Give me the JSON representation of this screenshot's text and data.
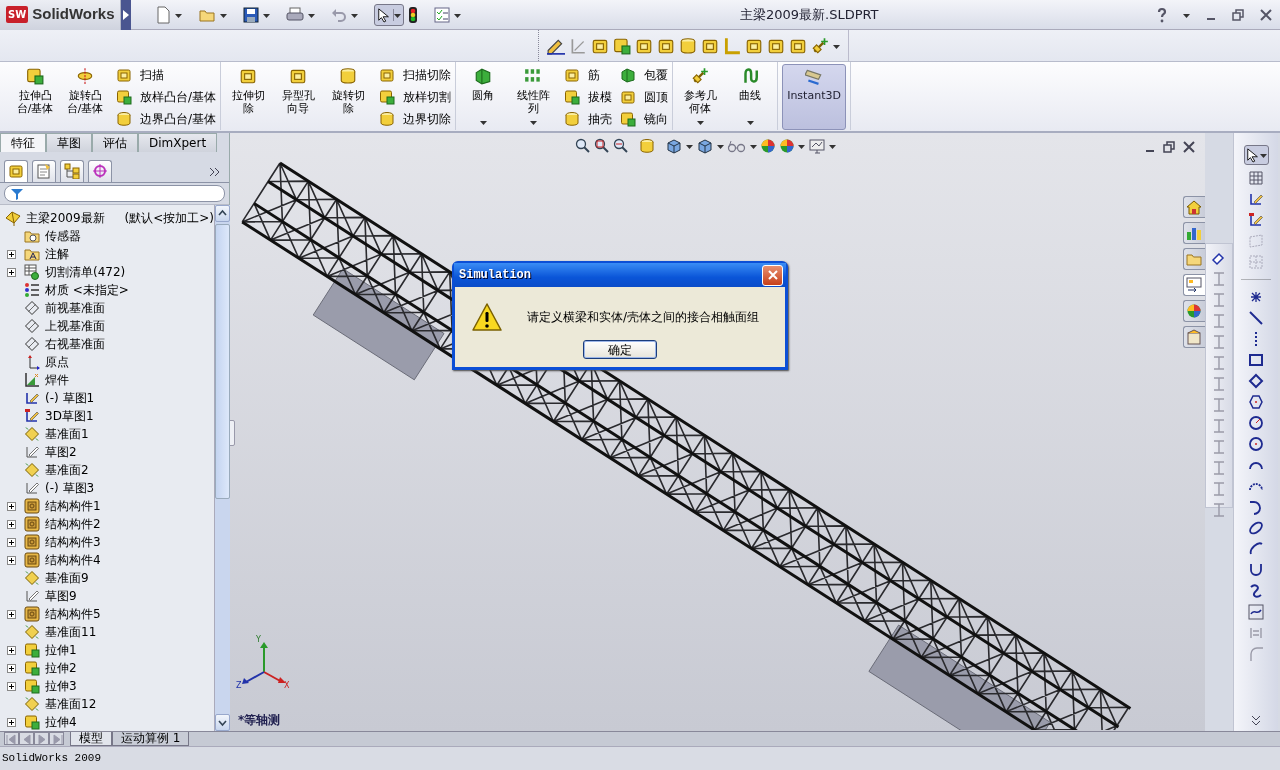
{
  "title_bar": {
    "logo_mark": "SW",
    "app_name": "SolidWorks",
    "document_title": "主梁2009最新.SLDPRT"
  },
  "ribbon": {
    "groups": [
      {
        "large": [
          {
            "label": "拉伸凸台/基体",
            "dropdown": false,
            "pressed": false
          },
          {
            "label": "旋转凸台/基体",
            "dropdown": false,
            "pressed": false
          }
        ],
        "small": [
          {
            "label": "扫描"
          },
          {
            "label": "放样凸台/基体"
          },
          {
            "label": "边界凸台/基体"
          }
        ]
      },
      {
        "large": [
          {
            "label": "拉伸切除",
            "dropdown": false,
            "pressed": false
          },
          {
            "label": "异型孔向导",
            "dropdown": false,
            "pressed": false
          },
          {
            "label": "旋转切除",
            "dropdown": false,
            "pressed": false
          }
        ],
        "small": [
          {
            "label": "扫描切除"
          },
          {
            "label": "放样切割"
          },
          {
            "label": "边界切除"
          }
        ]
      },
      {
        "large": [
          {
            "label": "圆角",
            "dropdown": true,
            "pressed": false
          },
          {
            "label": "线性阵列",
            "dropdown": true,
            "pressed": false
          }
        ],
        "small": [
          {
            "label": "筋"
          },
          {
            "label": "拔模"
          },
          {
            "label": "抽壳"
          },
          {
            "label": "包覆"
          },
          {
            "label": "圆顶"
          },
          {
            "label": "镜向"
          }
        ]
      },
      {
        "large": [
          {
            "label": "参考几何体",
            "dropdown": true,
            "pressed": false
          },
          {
            "label": "曲线",
            "dropdown": true,
            "pressed": false
          }
        ]
      },
      {
        "large": [
          {
            "label": "Instant3D",
            "dropdown": false,
            "pressed": true
          }
        ]
      }
    ]
  },
  "command_tabs": [
    {
      "label": "特征",
      "selected": true
    },
    {
      "label": "草图",
      "selected": false
    },
    {
      "label": "评估",
      "selected": false
    },
    {
      "label": "DimXpert",
      "selected": false
    }
  ],
  "feature_tree": {
    "root": {
      "label": "主梁2009最新",
      "configuration": "(默认<按加工>)"
    },
    "items": [
      {
        "kind": "sensor",
        "label": "传感器",
        "expandable": false
      },
      {
        "kind": "annotation",
        "label": "注解",
        "expandable": true
      },
      {
        "kind": "cutlist",
        "label": "切割清单(472)",
        "expandable": true
      },
      {
        "kind": "material",
        "label": "材质 <未指定>",
        "expandable": false
      },
      {
        "kind": "plane",
        "label": "前视基准面",
        "expandable": false
      },
      {
        "kind": "plane",
        "label": "上视基准面",
        "expandable": false
      },
      {
        "kind": "plane",
        "label": "右视基准面",
        "expandable": false
      },
      {
        "kind": "origin",
        "label": "原点",
        "expandable": false
      },
      {
        "kind": "weldment",
        "label": "焊件",
        "expandable": false
      },
      {
        "kind": "sketch",
        "label": "(-) 草图1",
        "expandable": false
      },
      {
        "kind": "sketch3d",
        "label": "3D草图1",
        "expandable": false
      },
      {
        "kind": "refplane",
        "label": "基准面1",
        "expandable": false
      },
      {
        "kind": "sketch_plain",
        "label": "草图2",
        "expandable": false
      },
      {
        "kind": "refplane",
        "label": "基准面2",
        "expandable": false
      },
      {
        "kind": "sketch_plain",
        "label": "(-) 草图3",
        "expandable": false
      },
      {
        "kind": "member",
        "label": "结构构件1",
        "expandable": true
      },
      {
        "kind": "member",
        "label": "结构构件2",
        "expandable": true
      },
      {
        "kind": "member",
        "label": "结构构件3",
        "expandable": true
      },
      {
        "kind": "member",
        "label": "结构构件4",
        "expandable": true
      },
      {
        "kind": "refplane",
        "label": "基准面9",
        "expandable": false
      },
      {
        "kind": "sketch_plain",
        "label": "草图9",
        "expandable": false
      },
      {
        "kind": "member",
        "label": "结构构件5",
        "expandable": true
      },
      {
        "kind": "refplane",
        "label": "基准面11",
        "expandable": false
      },
      {
        "kind": "extrude",
        "label": "拉伸1",
        "expandable": true
      },
      {
        "kind": "extrude",
        "label": "拉伸2",
        "expandable": true
      },
      {
        "kind": "extrude",
        "label": "拉伸3",
        "expandable": true
      },
      {
        "kind": "refplane",
        "label": "基准面12",
        "expandable": false
      },
      {
        "kind": "extrude",
        "label": "拉伸4",
        "expandable": true
      }
    ]
  },
  "task_pane": {
    "tabs": [
      {
        "kind": "home",
        "selected": false
      },
      {
        "kind": "library",
        "selected": false
      },
      {
        "kind": "folder",
        "selected": false
      },
      {
        "kind": "palette",
        "selected": true
      },
      {
        "kind": "appearance",
        "selected": false
      },
      {
        "kind": "custom",
        "selected": false
      }
    ]
  },
  "viewport": {
    "view_label": "*等轴测",
    "triad": {
      "x": "X",
      "y": "Y",
      "z": "Z"
    }
  },
  "dialog": {
    "title": "Simulation",
    "message": "请定义横梁和实体/壳体之间的接合相触面组",
    "button": "确定"
  },
  "bottom_tabs": [
    {
      "label": "模型",
      "selected": true
    },
    {
      "label": "运动算例 1",
      "selected": false
    }
  ],
  "status_bar": {
    "text": "SolidWorks 2009"
  }
}
